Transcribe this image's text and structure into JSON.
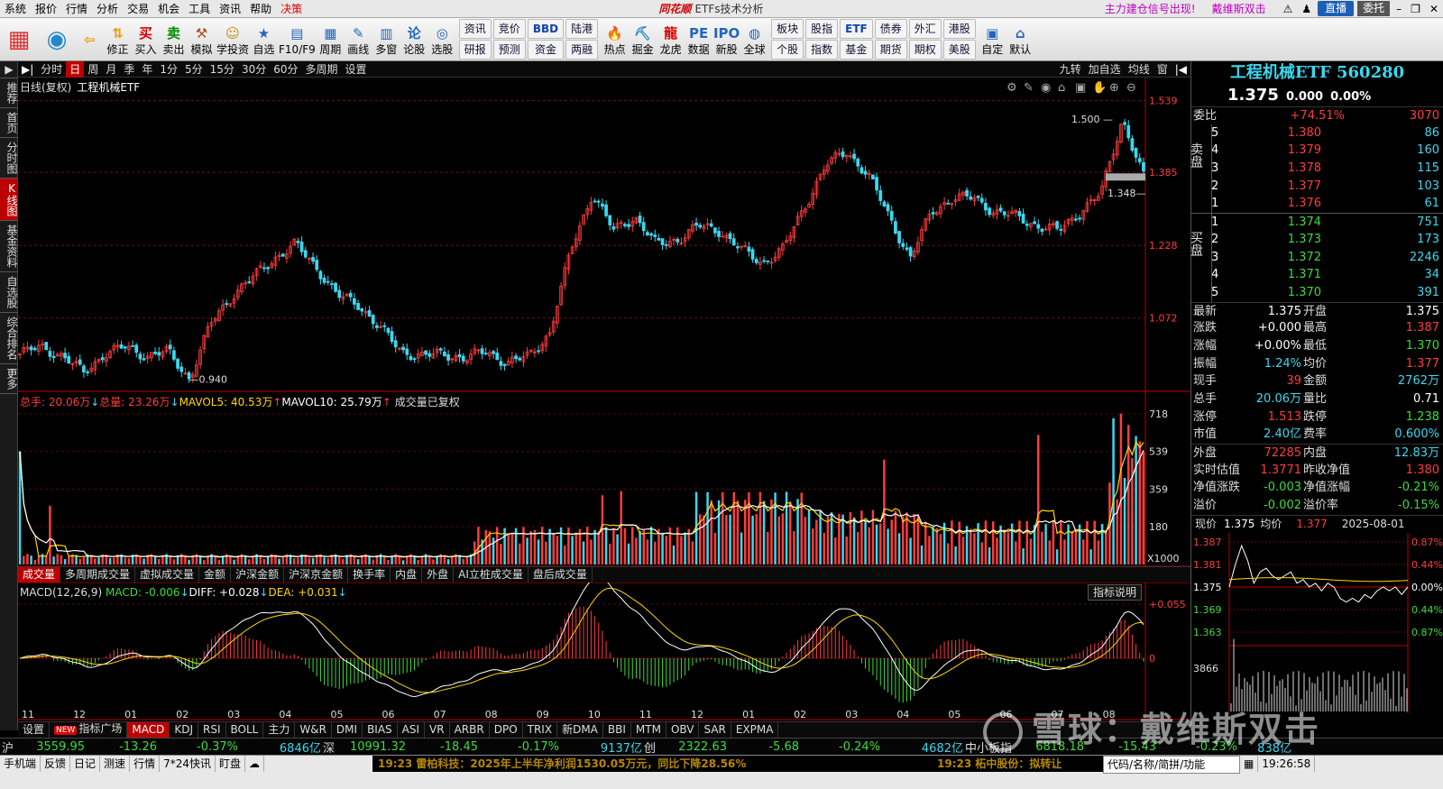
{
  "menu": {
    "items": [
      "系统",
      "报价",
      "行情",
      "分析",
      "交易",
      "机会",
      "工具",
      "资讯",
      "帮助",
      "决策"
    ],
    "app_logo": "同花顺",
    "window_title": "ETFs技术分析",
    "signal": "主力建仓信号出现!",
    "signal2": "戴维斯双击",
    "btn_live": "直播",
    "btn_entrust": "委托"
  },
  "toolbar": {
    "left": [
      {
        "icon": "app-icon",
        "label": ""
      },
      {
        "icon": "robot-icon",
        "label": ""
      },
      {
        "icon": "back-icon",
        "label": ""
      },
      {
        "icon": "up-down-icon",
        "label": "修正"
      },
      {
        "icon": "buy-icon",
        "label": "买入"
      },
      {
        "icon": "sell-icon",
        "label": "卖出"
      },
      {
        "icon": "hammer-icon",
        "label": "模拟"
      },
      {
        "icon": "study-icon",
        "label": "学投资"
      },
      {
        "icon": "star-icon",
        "label": "自选"
      },
      {
        "icon": "f10-icon",
        "label": "F10/F9"
      },
      {
        "icon": "calendar-icon",
        "label": "周期"
      },
      {
        "icon": "pen-icon",
        "label": "画线"
      },
      {
        "icon": "multi-icon",
        "label": "多窗"
      },
      {
        "icon": "stock-icon",
        "label": "论股"
      },
      {
        "icon": "select-icon",
        "label": "选股"
      }
    ],
    "grid1": [
      "资讯",
      "研报",
      "竞价",
      "预测",
      "BBD",
      "资金",
      "陆港",
      "两融"
    ],
    "mid": [
      {
        "icon": "hot-icon",
        "label": "热点"
      },
      {
        "icon": "dig-icon",
        "label": "掘金"
      },
      {
        "icon": "dragon-icon",
        "label": "龙虎"
      },
      {
        "icon": "pe-icon",
        "label": "数据"
      },
      {
        "icon": "ipo-icon",
        "label": "新股"
      },
      {
        "icon": "globe-icon",
        "label": "全球"
      }
    ],
    "grid2": [
      "板块",
      "个股",
      "股指",
      "指数",
      "ETF",
      "基金",
      "债券",
      "期货",
      "外汇",
      "期权",
      "港股",
      "美股"
    ],
    "right": [
      {
        "icon": "custom-icon",
        "label": "自定"
      },
      {
        "icon": "home-icon",
        "label": "默认"
      }
    ]
  },
  "side_tabs": [
    "推荐",
    "首页",
    "分时图",
    "K线图",
    "基金资料",
    "自选股",
    "综合排名",
    "更多"
  ],
  "period_tabs": [
    "分时",
    "日",
    "周",
    "月",
    "季",
    "年",
    "1分",
    "5分",
    "15分",
    "30分",
    "60分",
    "多周期",
    "设置"
  ],
  "period_right": [
    "九转",
    "加自选",
    "均线",
    "窗"
  ],
  "kline_info": {
    "mode": "日线(复权)",
    "name": "工程机械ETF"
  },
  "vol_info": {
    "total_hands": "总手: 20.06万",
    "total_vol": "总量: 23.26万",
    "mavol5": "MAVOL5: 40.53万",
    "mavol10": "MAVOL10: 25.79万",
    "note": "成交量已复权"
  },
  "sub_tabs": [
    "成交量",
    "多周期成交量",
    "虚拟成交量",
    "金额",
    "沪深金额",
    "沪深京金额",
    "换手率",
    "内盘",
    "外盘",
    "AI立桩成交量",
    "盘后成交量"
  ],
  "macd_info": {
    "name": "MACD(12,26,9)",
    "macd": "MACD: -0.006",
    "diff": "DIFF: +0.028",
    "dea": "DEA: +0.031"
  },
  "macd_help": "指标说明",
  "indicator_tabs": [
    "设置",
    "指标广场",
    "MACD",
    "KDJ",
    "RSI",
    "BOLL",
    "主力",
    "W&R",
    "DMI",
    "BIAS",
    "ASI",
    "VR",
    "ARBR",
    "DPO",
    "TRIX",
    "新DMA",
    "BBI",
    "MTM",
    "OBV",
    "SAR",
    "EXPMA"
  ],
  "indicator_new_badge": "NEW",
  "chart_data": [
    {
      "type": "candlestick",
      "title": "工程机械ETF",
      "y_ticks": [
        1.539,
        1.385,
        1.228,
        1.072
      ],
      "x_labels": [
        "11",
        "12",
        "01",
        "02",
        "03",
        "04",
        "05",
        "06",
        "07",
        "08",
        "09",
        "10",
        "11",
        "12",
        "01",
        "02",
        "03",
        "04",
        "05",
        "06",
        "07",
        "08"
      ],
      "annotations": [
        {
          "label": "1.500"
        },
        {
          "label": "0.940"
        },
        {
          "label": "1.348"
        }
      ],
      "waypoints": [
        0.995,
        1.01,
        0.99,
        0.955,
        0.995,
        1.01,
        0.99,
        1.0,
        0.94,
        1.06,
        1.12,
        1.16,
        1.2,
        1.23,
        1.18,
        1.12,
        1.1,
        1.05,
        1.0,
        0.99,
        0.995,
        0.985,
        1.0,
        0.975,
        0.99,
        1.04,
        1.22,
        1.34,
        1.26,
        1.29,
        1.23,
        1.24,
        1.27,
        1.26,
        1.22,
        1.19,
        1.22,
        1.31,
        1.4,
        1.43,
        1.38,
        1.29,
        1.2,
        1.3,
        1.33,
        1.33,
        1.3,
        1.29,
        1.27,
        1.26,
        1.3,
        1.34,
        1.5,
        1.375
      ]
    },
    {
      "type": "bar",
      "title": "成交量",
      "y_ticks": [
        718,
        539,
        359,
        180
      ],
      "unit": "X1000"
    },
    {
      "type": "bar",
      "title": "MACD",
      "y_ticks": [
        "+0.055",
        "0"
      ]
    }
  ],
  "quote": {
    "name": "工程机械ETF 560280",
    "price": "1.375",
    "change": "0.000",
    "pct": "0.00%",
    "weibi_label": "委比",
    "weibi": "+74.51%",
    "weicha": "3070",
    "sell_label": "卖盘",
    "buy_label": "买盘",
    "sells": [
      [
        "5",
        "1.380",
        "86"
      ],
      [
        "4",
        "1.379",
        "160"
      ],
      [
        "3",
        "1.378",
        "115"
      ],
      [
        "2",
        "1.377",
        "103"
      ],
      [
        "1",
        "1.376",
        "61"
      ]
    ],
    "buys": [
      [
        "1",
        "1.374",
        "751"
      ],
      [
        "2",
        "1.373",
        "173"
      ],
      [
        "3",
        "1.372",
        "2246"
      ],
      [
        "4",
        "1.371",
        "34"
      ],
      [
        "5",
        "1.370",
        "391"
      ]
    ],
    "stats": [
      [
        "最新",
        "1.375",
        "开盘",
        "1.375"
      ],
      [
        "涨跌",
        "+0.000",
        "最高",
        "1.387"
      ],
      [
        "涨幅",
        "+0.00%",
        "最低",
        "1.370"
      ],
      [
        "振幅",
        "1.24%",
        "均价",
        "1.377"
      ],
      [
        "现手",
        "39",
        "金额",
        "2762万"
      ],
      [
        "总手",
        "20.06万",
        "量比",
        "0.71"
      ],
      [
        "涨停",
        "1.513",
        "跌停",
        "1.238"
      ],
      [
        "市值",
        "2.40亿",
        "费率",
        "0.600%"
      ],
      [
        "外盘",
        "72285",
        "内盘",
        "12.83万"
      ],
      [
        "实时估值",
        "1.3771",
        "昨收净值",
        "1.380"
      ],
      [
        "净值涨跌",
        "-0.003",
        "净值涨幅",
        "-0.21%"
      ],
      [
        "溢价",
        "-0.002",
        "溢价率",
        "-0.15%"
      ]
    ],
    "mini_head": {
      "now_label": "现价",
      "now": "1.375",
      "avg_label": "均价",
      "avg": "1.377",
      "date": "2025-08-01"
    },
    "mini_left": [
      "1.387",
      "1.381",
      "1.375",
      "1.369",
      "1.363",
      "3866"
    ],
    "mini_right": [
      "0.87%",
      "0.44%",
      "0.00%",
      "0.44%",
      "0.87%"
    ]
  },
  "ticker": [
    {
      "k": "沪",
      "v": "3559.95",
      "c": "-13.26",
      "p": "-0.37%",
      "a": "6846亿"
    },
    {
      "k": "深",
      "v": "10991.32",
      "c": "-18.45",
      "p": "-0.17%",
      "a": "9137亿"
    },
    {
      "k": "创",
      "v": "2322.63",
      "c": "-5.68",
      "p": "-0.24%",
      "a": "4682亿"
    },
    {
      "k": "中小板指",
      "v": "6818.18",
      "c": "-15.43",
      "p": "-0.23%",
      "a": "838亿"
    }
  ],
  "status": {
    "items": [
      "手机端",
      "反馈",
      "日记",
      "测速",
      "行情",
      "7*24快讯",
      "盯盘"
    ],
    "news1": "19:23 雷柏科技：2025年上半年净利润1530.05万元，同比下降28.56%",
    "news2": "19:23 柘中股份：拟转让",
    "search": "代码/名称/简拼/功能",
    "time": "19:26:58"
  },
  "watermark": "雪球：戴维斯双击"
}
